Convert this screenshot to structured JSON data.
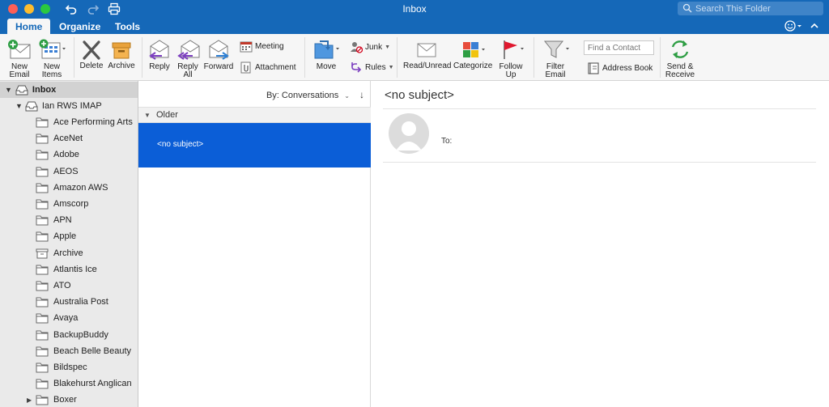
{
  "window": {
    "title": "Inbox"
  },
  "search": {
    "placeholder": "Search This Folder"
  },
  "tabs": [
    {
      "label": "Home",
      "active": true
    },
    {
      "label": "Organize",
      "active": false
    },
    {
      "label": "Tools",
      "active": false
    }
  ],
  "ribbon": {
    "new_email": "New\nEmail",
    "new_items": "New\nItems",
    "delete": "Delete",
    "archive": "Archive",
    "reply": "Reply",
    "reply_all": "Reply\nAll",
    "forward": "Forward",
    "meeting": "Meeting",
    "attachment": "Attachment",
    "move": "Move",
    "junk": "Junk",
    "rules": "Rules",
    "read_unread": "Read/Unread",
    "categorize": "Categorize",
    "follow_up": "Follow\nUp",
    "filter_email": "Filter\nEmail",
    "find_contact_placeholder": "Find a Contact",
    "address_book": "Address Book",
    "send_receive": "Send &\nReceive"
  },
  "folders": {
    "inbox": "Inbox",
    "account": "Ian RWS IMAP",
    "items": [
      "Ace Performing Arts",
      "AceNet",
      "Adobe",
      "AEOS",
      "Amazon AWS",
      "Amscorp",
      "APN",
      "Apple",
      "Archive",
      "Atlantis Ice",
      "ATO",
      "Australia Post",
      "Avaya",
      "BackupBuddy",
      "Beach Belle Beauty",
      "Bildspec",
      "Blakehurst Anglican",
      "Boxer"
    ]
  },
  "message_list": {
    "sort_label": "By: Conversations",
    "sort_direction": "↓",
    "group_label": "Older",
    "messages": [
      {
        "subject": "<no subject>",
        "selected": true
      }
    ]
  },
  "reading_pane": {
    "subject": "<no subject>",
    "to_label": "To:"
  },
  "colors": {
    "titlebar": "#1568b8",
    "selection": "#0b5ed7",
    "ribbon_bg": "#f6f6f6",
    "folder_pane_bg": "#eaeaea"
  }
}
